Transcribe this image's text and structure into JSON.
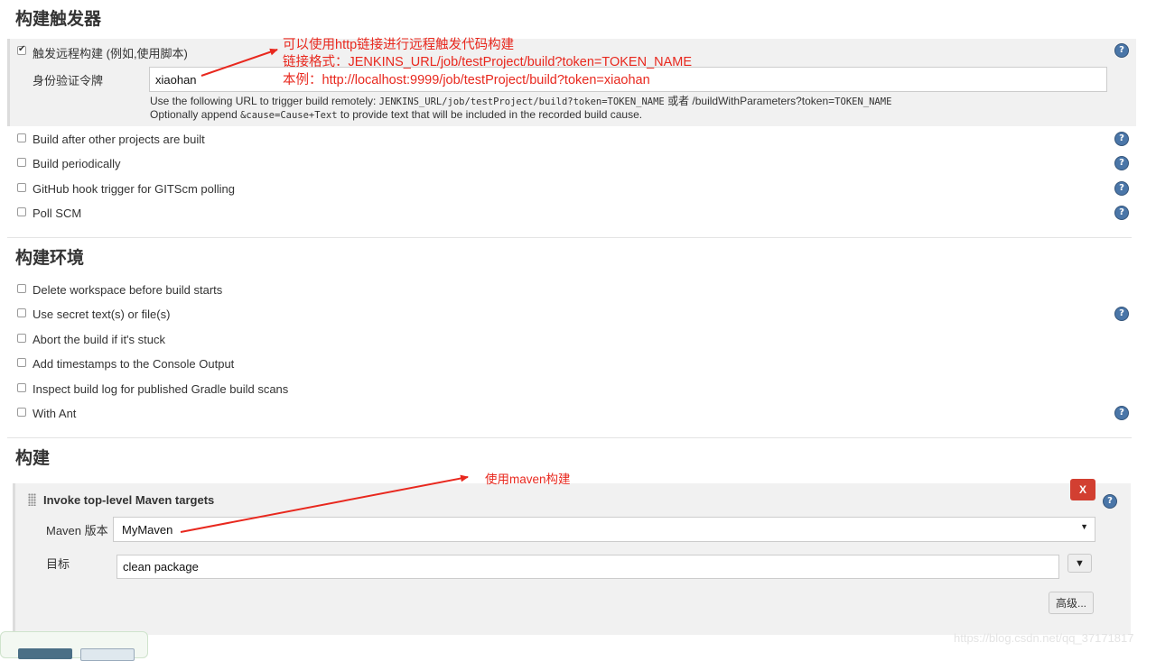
{
  "triggers": {
    "title": "构建触发器",
    "remote": {
      "label": "触发远程构建 (例如,使用脚本)",
      "checked": true,
      "token_label": "身份验证令牌",
      "token_value": "xiaohan",
      "desc1_pre": "Use the following URL to trigger build remotely: ",
      "desc1_code1": "JENKINS_URL/job/testProject/build?token=TOKEN_NAME",
      "desc1_mid": " 或者 /buildWithParameters?token=",
      "desc1_code2": "TOKEN_NAME",
      "desc2_pre": "Optionally append ",
      "desc2_code": "&cause=Cause+Text",
      "desc2_post": " to provide text that will be included in the recorded build cause."
    },
    "options": [
      {
        "label": "Build after other projects are built",
        "checked": false
      },
      {
        "label": "Build periodically",
        "checked": false
      },
      {
        "label": "GitHub hook trigger for GITScm polling",
        "checked": false
      },
      {
        "label": "Poll SCM",
        "checked": false
      }
    ]
  },
  "annotations": {
    "line1": "可以使用http链接进行远程触发代码构建",
    "line2": "链接格式：JENKINS_URL/job/testProject/build?token=TOKEN_NAME",
    "line3": "本例：http://localhost:9999/job/testProject/build?token=xiaohan",
    "maven_note": "使用maven构建"
  },
  "environment": {
    "title": "构建环境",
    "options": [
      {
        "label": "Delete workspace before build starts",
        "checked": false
      },
      {
        "label": "Use secret text(s) or file(s)",
        "checked": false
      },
      {
        "label": "Abort the build if it's stuck",
        "checked": false
      },
      {
        "label": "Add timestamps to the Console Output",
        "checked": false
      },
      {
        "label": "Inspect build log for published Gradle build scans",
        "checked": false
      },
      {
        "label": "With Ant",
        "checked": false
      }
    ]
  },
  "build": {
    "title": "构建",
    "step_title": "Invoke top-level Maven targets",
    "delete_label": "X",
    "maven_version_label": "Maven 版本",
    "maven_version_value": "MyMaven",
    "goals_label": "目标",
    "goals_value": "clean package",
    "advanced_label": "高级..."
  },
  "help_glyph": "?",
  "watermark": "https://blog.csdn.net/qq_37171817",
  "colors": {
    "annotation": "#e8281e",
    "help": "#4a76a8",
    "delete": "#d23f31"
  }
}
